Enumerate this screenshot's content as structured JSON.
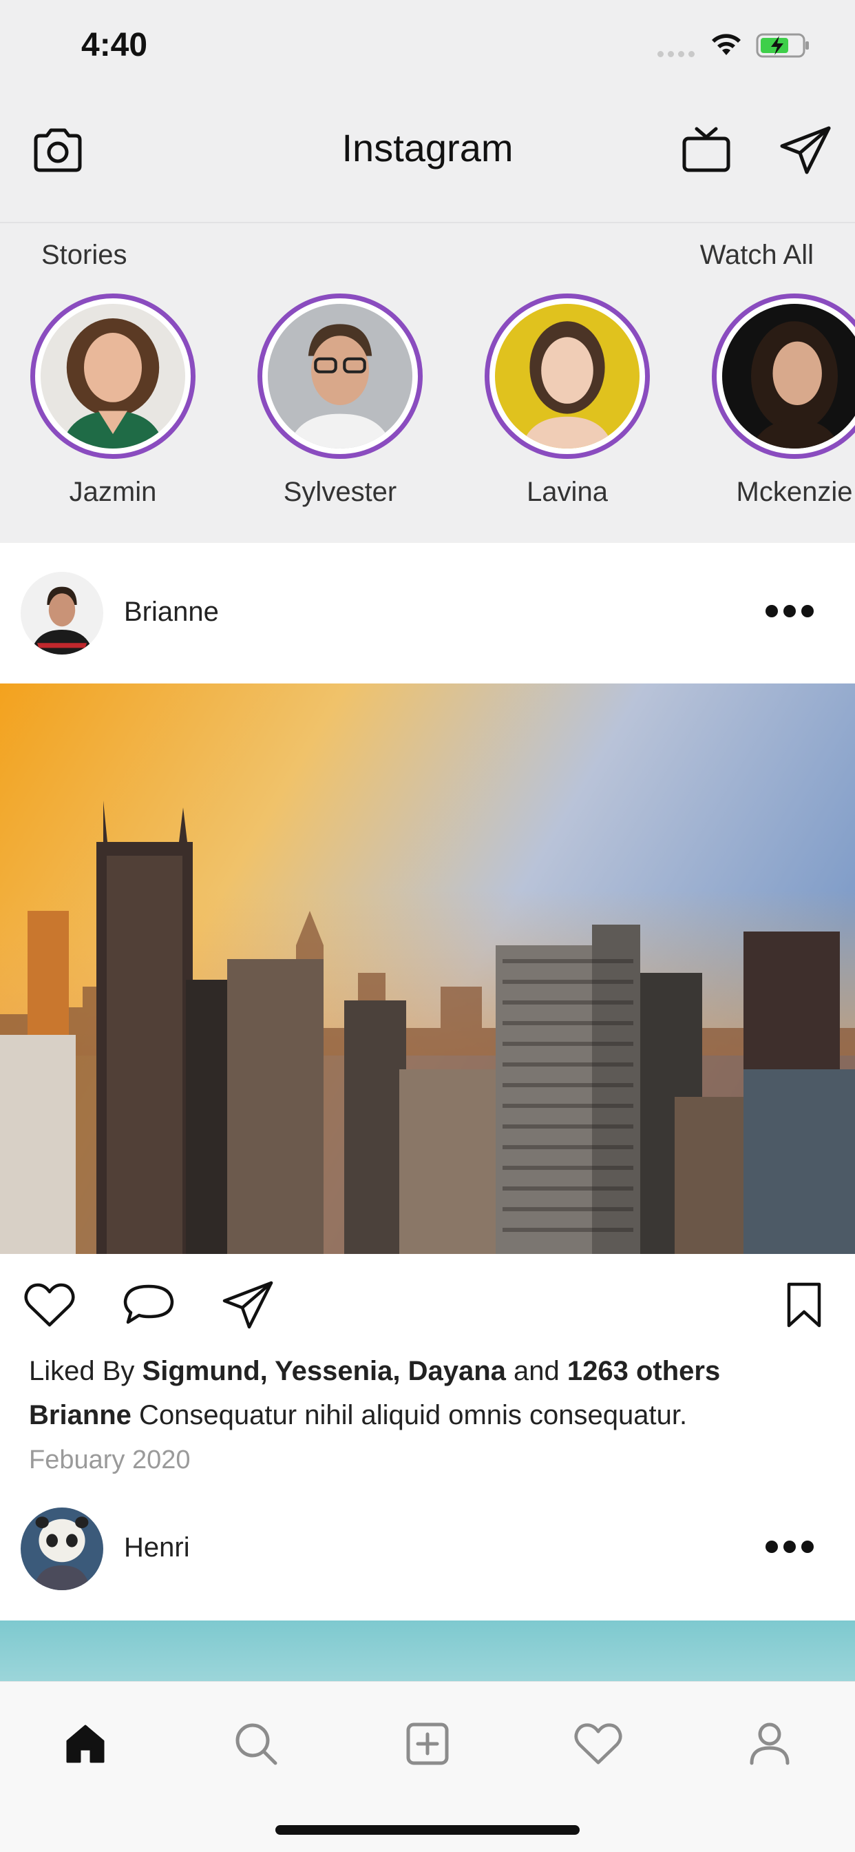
{
  "status_bar": {
    "time": "4:40"
  },
  "header": {
    "title": "Instagram"
  },
  "stories": {
    "label": "Stories",
    "watch_all": "Watch All",
    "items": [
      {
        "name": "Jazmin"
      },
      {
        "name": "Sylvester"
      },
      {
        "name": "Lavina"
      },
      {
        "name": "Mckenzie"
      }
    ]
  },
  "posts": [
    {
      "username": "Brianne",
      "liked_prefix": "Liked By ",
      "liked_names": "Sigmund, Yessenia, Dayana",
      "liked_and": " and ",
      "liked_others": "1263 others",
      "caption_user": "Brianne",
      "caption_text": " Consequatur nihil aliquid omnis consequatur.",
      "date": "Febuary 2020"
    },
    {
      "username": "Henri"
    }
  ],
  "colors": {
    "story_ring": "#8a4cbf",
    "header_bg": "#efeff0",
    "date_text": "#9a9a9a"
  },
  "icons": {
    "header": [
      "camera-icon",
      "tv-icon",
      "send-icon"
    ],
    "post_actions": [
      "heart-icon",
      "comment-icon",
      "share-icon",
      "bookmark-icon"
    ],
    "tabs": [
      "home-icon",
      "search-icon",
      "add-post-icon",
      "activity-heart-icon",
      "profile-icon"
    ]
  }
}
